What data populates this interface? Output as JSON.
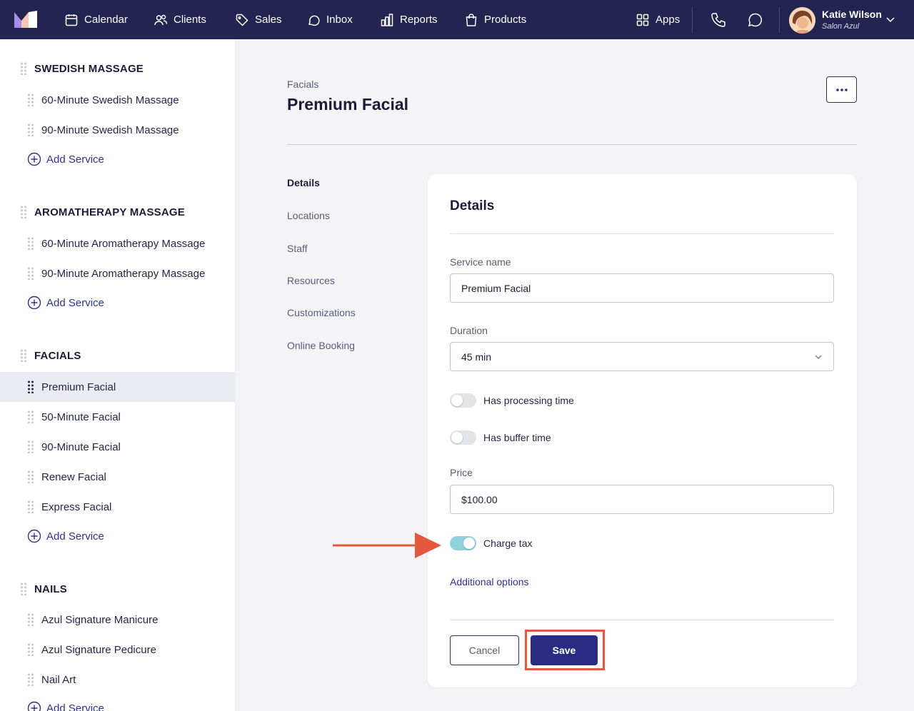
{
  "topbar": {
    "nav": [
      {
        "label": "Calendar",
        "icon": "calendar-icon"
      },
      {
        "label": "Clients",
        "icon": "users-icon"
      },
      {
        "label": "Sales",
        "icon": "tag-icon"
      },
      {
        "label": "Inbox",
        "icon": "chat-bubble-icon"
      },
      {
        "label": "Reports",
        "icon": "bar-chart-icon"
      },
      {
        "label": "Products",
        "icon": "shopping-bag-icon"
      }
    ],
    "apps_label": "Apps",
    "user": {
      "name": "Katie Wilson",
      "salon": "Salon Azul"
    }
  },
  "sidebar": {
    "categories": [
      {
        "name": "SWEDISH MASSAGE",
        "services": [
          "60-Minute Swedish Massage",
          "90-Minute Swedish Massage"
        ]
      },
      {
        "name": "AROMATHERAPY MASSAGE",
        "services": [
          "60-Minute Aromatherapy Massage",
          "90-Minute Aromatherapy Massage"
        ]
      },
      {
        "name": "FACIALS",
        "services": [
          "Premium Facial",
          "50-Minute Facial",
          "90-Minute Facial",
          "Renew Facial",
          "Express Facial"
        ]
      },
      {
        "name": "NAILS",
        "services": [
          "Azul Signature Manicure",
          "Azul Signature Pedicure",
          "Nail Art"
        ]
      }
    ],
    "add_service_label": "Add Service",
    "active_service": "Premium Facial"
  },
  "header": {
    "breadcrumb": "Facials",
    "title": "Premium Facial"
  },
  "section_nav": [
    "Details",
    "Locations",
    "Staff",
    "Resources",
    "Customizations",
    "Online Booking"
  ],
  "form": {
    "title": "Details",
    "service_name_label": "Service name",
    "service_name_value": "Premium Facial",
    "duration_label": "Duration",
    "duration_value": "45 min",
    "processing_time_label": "Has processing time",
    "processing_time_on": false,
    "buffer_time_label": "Has buffer time",
    "buffer_time_on": false,
    "price_label": "Price",
    "price_value": "$100.00",
    "charge_tax_label": "Charge tax",
    "charge_tax_on": true,
    "additional_options": "Additional options",
    "cancel_label": "Cancel",
    "save_label": "Save"
  },
  "colors": {
    "navbar": "#23244f",
    "accent": "#2a2c83",
    "toggle_on": "#8fd2dc",
    "annotation": "#e5573f"
  }
}
